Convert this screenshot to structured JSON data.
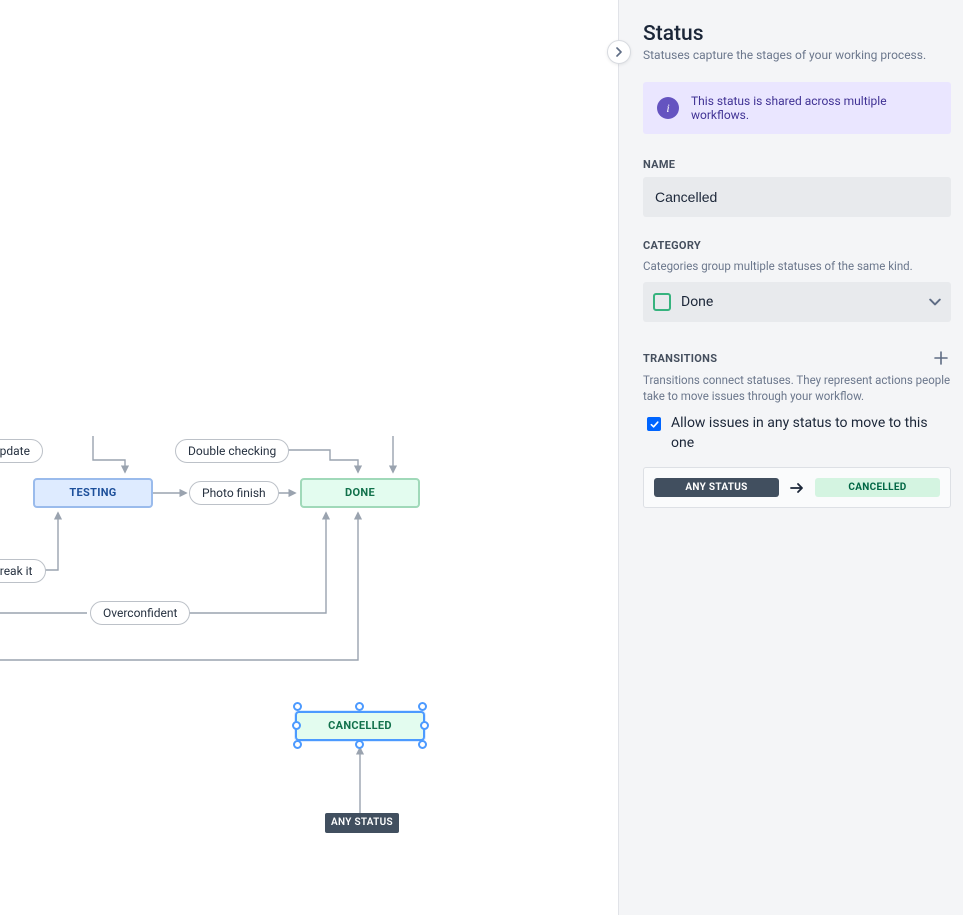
{
  "canvas": {
    "statuses": {
      "testing": "Testing",
      "done": "Done",
      "cancelled": "Cancelled",
      "any": "ANY STATUS"
    },
    "transitions": {
      "update": "update",
      "double_checking": "Double checking",
      "photo_finish": "Photo finish",
      "break_it": "break it",
      "overconfident": "Overconfident"
    }
  },
  "panel": {
    "title": "Status",
    "subtitle": "Statuses capture the stages of your working process.",
    "banner": "This status is shared across multiple workflows.",
    "name": {
      "label": "Name",
      "value": "Cancelled"
    },
    "category": {
      "label": "Category",
      "help": "Categories group multiple statuses of the same kind.",
      "value": "Done"
    },
    "transitions": {
      "label": "Transitions",
      "help": "Transitions connect statuses. They represent actions people take to move issues through your workflow.",
      "allow_any": "Allow issues in any status to move to this one",
      "entry": {
        "from": "Any Status",
        "to": "Cancelled"
      }
    }
  }
}
